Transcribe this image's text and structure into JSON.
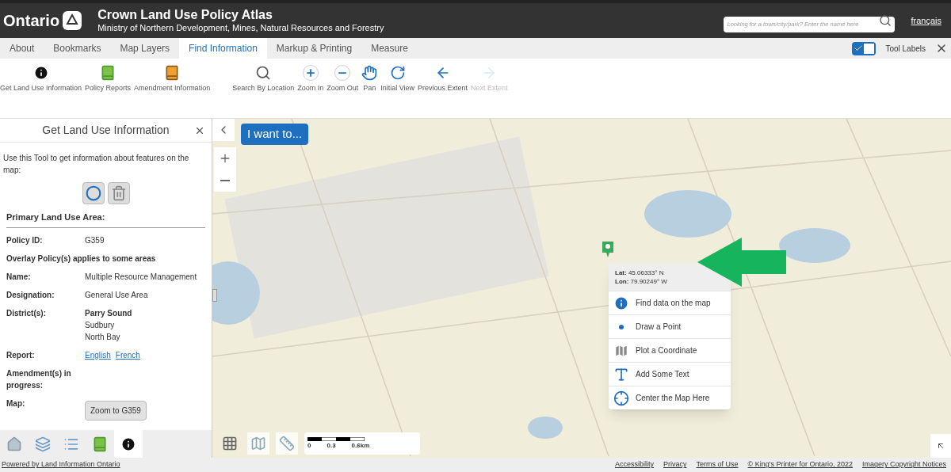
{
  "header": {
    "logo": "Ontario",
    "title": "Crown Land Use Policy Atlas",
    "subtitle": "Ministry of Northern Development, Mines, Natural Resources and Forestry",
    "search": {
      "placeholder": "Looking for a town/city/park? Enter the name here"
    },
    "language_link": "français"
  },
  "tabs": [
    {
      "label": "About",
      "selected": false
    },
    {
      "label": "Bookmarks",
      "selected": false
    },
    {
      "label": "Map Layers",
      "selected": false
    },
    {
      "label": "Find Information",
      "selected": true
    },
    {
      "label": "Markup & Printing",
      "selected": false
    },
    {
      "label": "Measure",
      "selected": false
    }
  ],
  "tool_labels": {
    "label": "Tool Labels",
    "on": true
  },
  "toolbar": [
    {
      "kind": "info",
      "label": "Get Land Use Information",
      "disabled": false
    },
    {
      "kind": "book-green",
      "label": "Policy Reports",
      "disabled": false
    },
    {
      "kind": "book-orange",
      "label": "Amendment Information",
      "disabled": false
    },
    {
      "kind": "search",
      "label": "Search By Location",
      "disabled": false
    },
    {
      "kind": "zoom-in",
      "label": "Zoom In",
      "disabled": false
    },
    {
      "kind": "zoom-out",
      "label": "Zoom Out",
      "disabled": false
    },
    {
      "kind": "pan",
      "label": "Pan",
      "disabled": false
    },
    {
      "kind": "initial",
      "label": "Initial View",
      "disabled": false
    },
    {
      "kind": "previous",
      "label": "Previous Extent",
      "disabled": false
    },
    {
      "kind": "next",
      "label": "Next Extent",
      "disabled": true
    }
  ],
  "panel": {
    "title": "Get Land Use Information",
    "description": "Use this Tool to get information about features on the map:",
    "section_title": "Primary Land Use Area:",
    "rows": [
      {
        "kind": "text",
        "label": "Policy ID:",
        "value": "G359"
      },
      {
        "kind": "note",
        "label": "Overlay Policy(s) applies to some areas"
      },
      {
        "kind": "text",
        "label": "Name:",
        "value": "Multiple Resource Management"
      },
      {
        "kind": "text",
        "label": "Designation:",
        "value": "General Use Area"
      },
      {
        "kind": "lines",
        "label": "District(s):",
        "lines": [
          {
            "text": "Parry Sound",
            "primary": true
          },
          {
            "text": "Sudbury",
            "primary": false
          },
          {
            "text": "North Bay",
            "primary": false
          }
        ]
      },
      {
        "kind": "links",
        "label": "Report:",
        "links": [
          "English",
          "French"
        ]
      },
      {
        "kind": "empty",
        "label": "Amendment(s) in progress:"
      },
      {
        "kind": "button",
        "label": "Map:",
        "value": "Zoom to G359"
      }
    ]
  },
  "panel_tabs": [
    {
      "kind": "home",
      "selected": false
    },
    {
      "kind": "layers",
      "selected": false
    },
    {
      "kind": "legend",
      "selected": false
    },
    {
      "kind": "book",
      "selected": false
    },
    {
      "kind": "info",
      "selected": true
    }
  ],
  "map": {
    "menu_button": "I want to...",
    "popup": {
      "lat": "**Lat:** 45.06333° N",
      "lon": "**Lon:** 79.90249° W",
      "items": [
        {
          "kind": "find",
          "label": "Find data on the map"
        },
        {
          "kind": "point",
          "label": "Draw a Point"
        },
        {
          "kind": "plot",
          "label": "Plot a Coordinate"
        },
        {
          "kind": "text",
          "label": "Add Some Text"
        },
        {
          "kind": "center",
          "label": "Center the Map Here"
        }
      ]
    },
    "scale_labels": [
      "0",
      "0.3",
      "0.6km"
    ]
  },
  "footer": {
    "credit": "Powered by Land Information Ontario",
    "links": [
      "Accessibility",
      "Privacy",
      "Terms of Use",
      "© King's Printer for Ontario, 2022",
      "Imagery Copyright Notices"
    ]
  }
}
